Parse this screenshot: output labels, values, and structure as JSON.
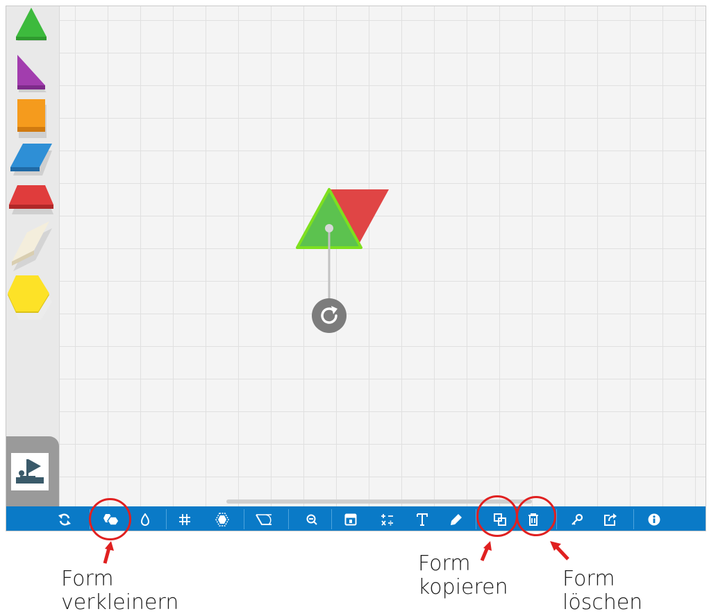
{
  "palette": {
    "shapes": [
      {
        "name": "triangle",
        "color": "#3dba3d"
      },
      {
        "name": "right-triangle",
        "color": "#a23dae"
      },
      {
        "name": "square",
        "color": "#f59b1d"
      },
      {
        "name": "blue-rhombus",
        "color": "#2e8fd6"
      },
      {
        "name": "trapezoid",
        "color": "#e03c3c"
      },
      {
        "name": "thin-rhombus",
        "color": "#f4eedc"
      },
      {
        "name": "hexagon",
        "color": "#fde227"
      }
    ],
    "stamp_icon": "stamp-icon"
  },
  "canvas": {
    "selected_shape": {
      "name": "triangle",
      "color": "#5cc24f",
      "outline": "#7ee01f"
    },
    "attached_shape": {
      "name": "triangle",
      "color": "#e04545"
    },
    "rotate_icon": "rotate-icon"
  },
  "toolbar": {
    "background": "#0a7ac7",
    "buttons": [
      {
        "name": "reset-button",
        "icon": "refresh-icon"
      },
      {
        "name": "resize-shape-button",
        "icon": "hexagon-shrink-icon"
      },
      {
        "name": "color-button",
        "icon": "drop-icon"
      },
      {
        "name": "grid-button",
        "icon": "grid-icon"
      },
      {
        "name": "outline-button",
        "icon": "outline-icon"
      },
      {
        "name": "angle-button",
        "icon": "angle-icon"
      },
      {
        "name": "zoom-out-button",
        "icon": "zoom-out-icon"
      },
      {
        "name": "fraction-button",
        "icon": "counter-icon"
      },
      {
        "name": "equation-button",
        "icon": "math-icon"
      },
      {
        "name": "text-button",
        "icon": "text-icon"
      },
      {
        "name": "pen-button",
        "icon": "pen-icon"
      },
      {
        "name": "copy-shape-button",
        "icon": "copy-icon"
      },
      {
        "name": "delete-shape-button",
        "icon": "trash-icon"
      },
      {
        "name": "key-button",
        "icon": "key-icon"
      },
      {
        "name": "share-button",
        "icon": "share-icon"
      },
      {
        "name": "info-button",
        "icon": "info-icon"
      }
    ]
  },
  "annotations": {
    "highlight_color": "#e02020",
    "captions": [
      {
        "line1": "Form",
        "line2": "verkleinern"
      },
      {
        "line1": "Form",
        "line2": "kopieren"
      },
      {
        "line1": "Form",
        "line2": "löschen"
      }
    ]
  }
}
